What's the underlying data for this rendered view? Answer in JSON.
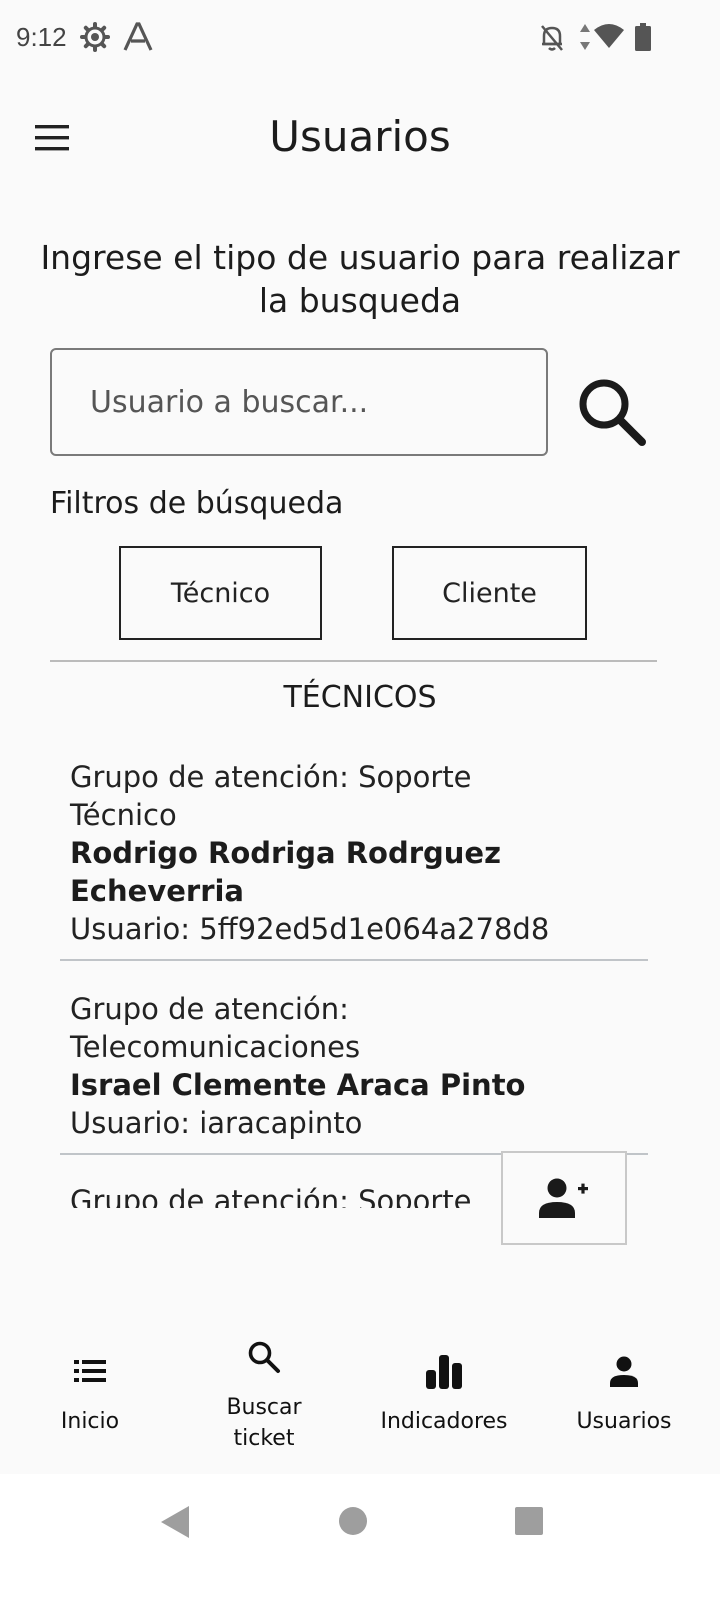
{
  "status_bar": {
    "time": "9:12",
    "icons": [
      "settings-gear-icon",
      "font-a-icon",
      "notifications-off-icon",
      "data-arrows-icon",
      "wifi-icon",
      "battery-icon"
    ]
  },
  "app_bar": {
    "title": "Usuarios",
    "menu_icon": "hamburger-menu-icon"
  },
  "search": {
    "prompt": "Ingrese el tipo de usuario para realizar la busqueda",
    "placeholder": "Usuario a buscar...",
    "value": "",
    "button_icon": "search-icon"
  },
  "filters": {
    "title": "Filtros de búsqueda",
    "options": [
      "Técnico",
      "Cliente"
    ]
  },
  "section": {
    "title": "TÉCNICOS"
  },
  "technicians": [
    {
      "group_line1": "Grupo de atención: Soporte",
      "group_line2": "Técnico",
      "name_line1": "Rodrigo Rodriga Rodrguez",
      "name_line2": "Echeverria",
      "user": "Usuario: 5ff92ed5d1e064a278d8"
    },
    {
      "group_line1": "Grupo de atención:",
      "group_line2": "Telecomunicaciones",
      "name_line1": "Israel Clemente Araca Pinto",
      "user": "Usuario: iaracapinto"
    },
    {
      "group_line1": "Grupo de atención: Soporte"
    }
  ],
  "fab": {
    "icon": "add-user-icon"
  },
  "bottom_nav": [
    {
      "label": "Inicio",
      "icon": "list-icon"
    },
    {
      "label": "Buscar ticket",
      "label_line1": "Buscar",
      "label_line2": "ticket",
      "icon": "search-icon"
    },
    {
      "label": "Indicadores",
      "icon": "bar-chart-icon"
    },
    {
      "label": "Usuarios",
      "icon": "person-icon"
    }
  ],
  "system_nav": [
    "back-icon",
    "home-icon",
    "recents-icon"
  ],
  "colors": {
    "background": "#fafafa",
    "text": "#1c1c1c",
    "divider": "#bbbbbb",
    "system_nav_icon": "#9e9e9e"
  }
}
